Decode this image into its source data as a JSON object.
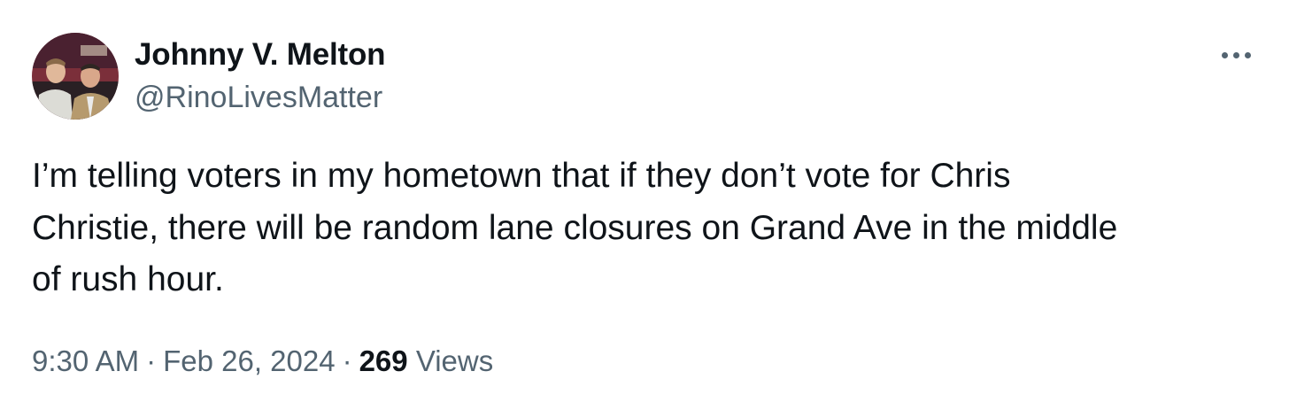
{
  "author": {
    "display_name": "Johnny V. Melton",
    "handle": "@RinoLivesMatter"
  },
  "tweet": {
    "text_lines": [
      "I’m telling voters in my hometown that if they don’t vote for Chris",
      "Christie, there will be random lane closures on Grand Ave in the middle",
      "of rush hour."
    ]
  },
  "meta": {
    "time": "9:30 AM",
    "separator": "·",
    "date": "Feb 26, 2024",
    "views_count": "269",
    "views_label": "Views"
  },
  "icons": {
    "more": "more-horizontal-icon"
  },
  "colors": {
    "text_primary": "#0f1419",
    "text_secondary": "#536471",
    "background": "#ffffff"
  }
}
